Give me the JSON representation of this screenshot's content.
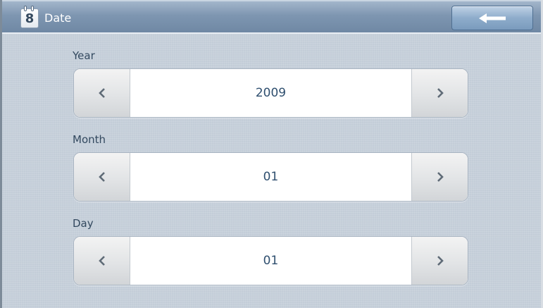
{
  "window": {
    "title": "Date",
    "title_icon_text": "8",
    "back_icon": "left-arrow-icon"
  },
  "fields": [
    {
      "label": "Year",
      "value": "2009",
      "prev_icon": "chevron-left-icon",
      "next_icon": "chevron-right-icon"
    },
    {
      "label": "Month",
      "value": "01",
      "prev_icon": "chevron-left-icon",
      "next_icon": "chevron-right-icon"
    },
    {
      "label": "Day",
      "value": "01",
      "prev_icon": "chevron-left-icon",
      "next_icon": "chevron-right-icon"
    }
  ],
  "colors": {
    "titlebar": "#7e96b1",
    "background": "#c3cdd8",
    "label_text": "#33495f",
    "value_text": "#2f4f6f"
  }
}
